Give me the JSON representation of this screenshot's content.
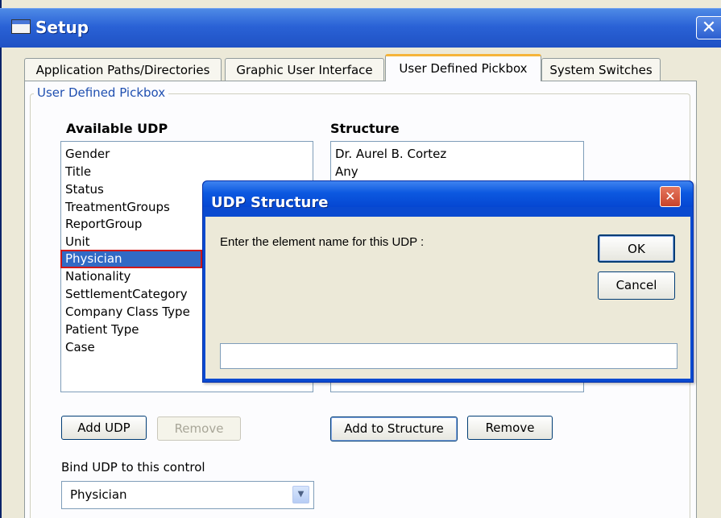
{
  "window": {
    "title": "Setup",
    "close_glyph": "✕",
    "icon": "window-icon"
  },
  "tabs": [
    {
      "label": "Application Paths/Directories",
      "active": false
    },
    {
      "label": "Graphic User Interface",
      "active": false
    },
    {
      "label": "User Defined Pickbox",
      "active": true
    },
    {
      "label": "System Switches",
      "active": false
    }
  ],
  "panel": {
    "group_title": "User Defined Pickbox",
    "available": {
      "heading": "Available UDP",
      "items": [
        "Gender",
        "Title",
        "Status",
        "TreatmentGroups",
        "ReportGroup",
        "Unit",
        "Physician",
        "Nationality",
        "SettlementCategory",
        "Company Class Type",
        "Patient Type",
        "Case"
      ],
      "selected": "Physician",
      "add_label": "Add UDP",
      "remove_label": "Remove"
    },
    "structure": {
      "heading": "Structure",
      "items": [
        "Dr. Aurel B. Cortez",
        "Any"
      ],
      "add_label": "Add to Structure",
      "remove_label": "Remove"
    },
    "bind": {
      "label": "Bind UDP to this control",
      "value": "Physician"
    }
  },
  "dialog": {
    "title": "UDP Structure",
    "close_glyph": "✕",
    "prompt": "Enter the element name for this UDP :",
    "ok_label": "OK",
    "cancel_label": "Cancel",
    "input_value": ""
  },
  "colors": {
    "selection": "#316ac5",
    "selection_outline": "#d01818",
    "titlebar": "#2a62d6",
    "tab_highlight": "#f5b43a",
    "dialog_close": "#d8573c"
  }
}
